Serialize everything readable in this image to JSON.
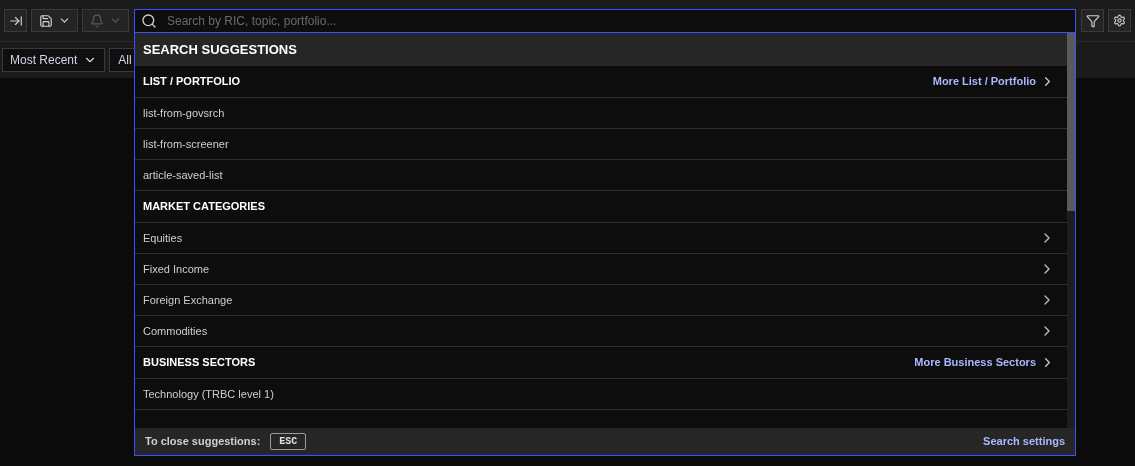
{
  "toolbar": {
    "bell_disabled": true
  },
  "filters": {
    "sort": "Most Recent",
    "type": "All"
  },
  "search": {
    "placeholder": "Search by RIC, topic, portfolio..."
  },
  "suggestions": {
    "title": "SEARCH SUGGESTIONS",
    "sections": [
      {
        "heading": "LIST / PORTFOLIO",
        "more": "More List / Portfolio",
        "items": [
          {
            "label": "list-from-govsrch",
            "has_arrow": false
          },
          {
            "label": "list-from-screener",
            "has_arrow": false
          },
          {
            "label": "article-saved-list",
            "has_arrow": false
          }
        ]
      },
      {
        "heading": "MARKET CATEGORIES",
        "items": [
          {
            "label": "Equities",
            "has_arrow": true
          },
          {
            "label": "Fixed Income",
            "has_arrow": true
          },
          {
            "label": "Foreign Exchange",
            "has_arrow": true
          },
          {
            "label": "Commodities",
            "has_arrow": true
          }
        ]
      },
      {
        "heading": "BUSINESS SECTORS",
        "more": "More Business Sectors",
        "items": [
          {
            "label": "Technology (TRBC level 1)",
            "has_arrow": false
          }
        ]
      }
    ],
    "footer": {
      "hint": "To close suggestions:",
      "key": "ESC",
      "settings": "Search settings"
    }
  }
}
